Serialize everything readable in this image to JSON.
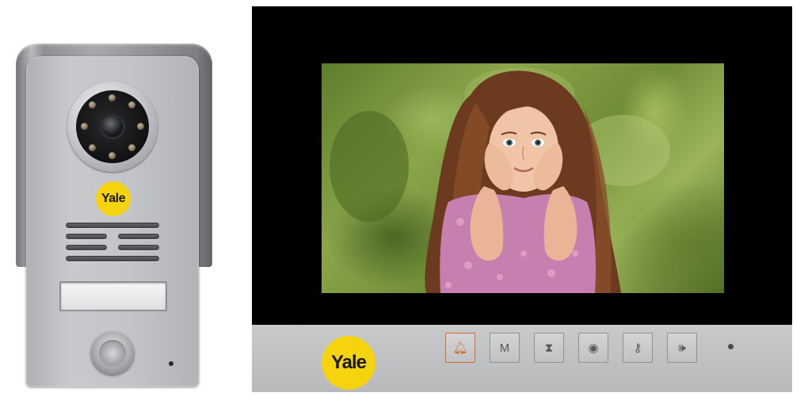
{
  "door_station": {
    "logo_text": "Yale"
  },
  "monitor": {
    "logo_text": "Yale",
    "buttons": [
      {
        "name": "bell-button",
        "icon": "bell-icon",
        "glyph": "🔔︎",
        "active": true
      },
      {
        "name": "menu-button",
        "icon": "m-letter-icon",
        "glyph": "M",
        "active": false
      },
      {
        "name": "intercom-button",
        "icon": "hourglass-icon",
        "glyph": "⧗",
        "active": false
      },
      {
        "name": "monitor-view-button",
        "icon": "eye-icon",
        "glyph": "◉",
        "active": false
      },
      {
        "name": "unlock-button",
        "icon": "key-icon",
        "glyph": "⚷",
        "active": false
      },
      {
        "name": "talk-button",
        "icon": "speaker-icon",
        "glyph": "🕪︎",
        "active": false
      }
    ]
  },
  "colors": {
    "brand_yellow": "#f5d30f",
    "active_orange": "#d8682c",
    "monitor_black": "#000000",
    "bar_silver": "#c2c3c5"
  }
}
